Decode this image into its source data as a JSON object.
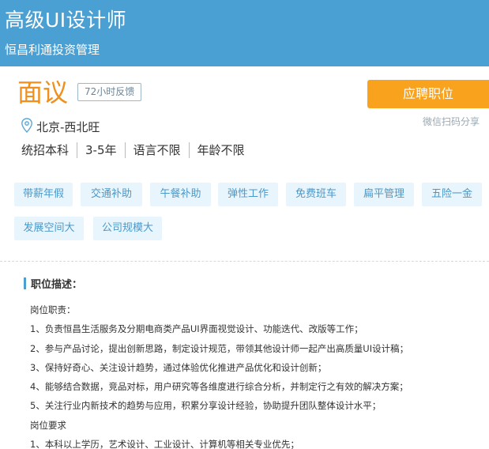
{
  "header": {
    "job_title": "高级UI设计师",
    "company": "恒昌利通投资管理",
    "background_color": "#4ba0d3"
  },
  "salary": "面议",
  "feedback_badge": "72小时反馈",
  "apply_button": "应聘职位",
  "share_link": "微信扫码分享",
  "location": "北京-西北旺",
  "requirements": [
    "统招本科",
    "3-5年",
    "语言不限",
    "年龄不限"
  ],
  "benefit_tags": [
    "带薪年假",
    "交通补助",
    "午餐补助",
    "弹性工作",
    "免费班车",
    "扁平管理",
    "五险一金",
    "发展空间大",
    "公司规模大"
  ],
  "description": {
    "title": "职位描述：",
    "lines": [
      "岗位职责：",
      "1、负责恒昌生活服务及分期电商类产品UI界面视觉设计、功能迭代、改版等工作；",
      "2、参与产品讨论，提出创新思路，制定设计规范，带领其他设计师一起产出高质量UI设计稿；",
      "3、保持好奇心、关注设计趋势，通过体验优化推进产品优化和设计创新；",
      "4、能够结合数据，竞品对标，用户研究等各维度进行综合分析，并制定行之有效的解决方案；",
      "5、关注行业内新技术的趋势与应用，积累分享设计经验，协助提升团队整体设计水平；",
      "岗位要求",
      "1、本科以上学历，艺术设计、工业设计、计算机等相关专业优先；"
    ]
  },
  "colors": {
    "accent_orange": "#f9a21d",
    "salary_orange": "#f08f1c",
    "tag_background": "#e9f5fc",
    "tag_text": "#4b98c8"
  }
}
